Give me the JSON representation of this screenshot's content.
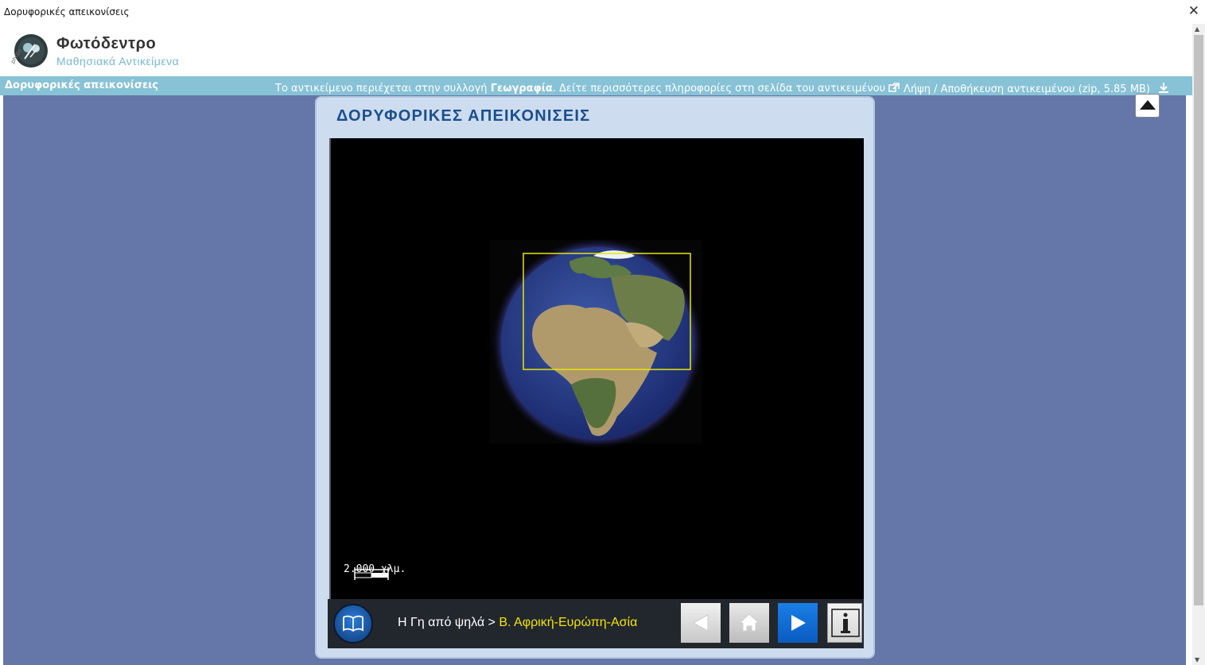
{
  "window": {
    "title": "Δορυφορικές απεικονίσεις",
    "close_symbol": "✕"
  },
  "header": {
    "brand": "Φωτόδεντρο",
    "subtitle": "Μαθησιακά Αντικείμενα"
  },
  "infobar": {
    "left_title": "Δορυφορικές απεικονίσεις",
    "info_prefix": "Το αντικείμενο περιέχεται στην συλλογή ",
    "collection": "Γεωγραφία",
    "info_suffix": ". Δείτε περισσότερες πληροφορίες στη σελίδα του αντικειμένου",
    "download": "Λήψη / Αποθήκευση αντικειμένου (zip, 5.85 MB)"
  },
  "panel": {
    "title": "ΔΟΡΥΦΟΡΙΚΕΣ ΑΠΕΙΚΟΝΙΣΕΙΣ",
    "scale_label": "2.000 χλμ."
  },
  "toolbar": {
    "crumb_root": "Η Γη από ψηλά > ",
    "crumb_current": "Β. Αφρική-Ευρώπη-Ασία"
  },
  "icons": {
    "close": "close-icon",
    "external_link": "external-link-icon",
    "download": "download-icon",
    "scroll_up": "arrow-up-icon",
    "book": "book-icon",
    "prev": "arrow-left-icon",
    "home": "home-icon",
    "next": "arrow-right-icon",
    "info": "info-icon"
  },
  "colors": {
    "background": "#6477a8",
    "infobar": "#87c2d6",
    "panel": "#cddcee",
    "title": "#1a4f8e",
    "highlight": "#f2e600"
  }
}
